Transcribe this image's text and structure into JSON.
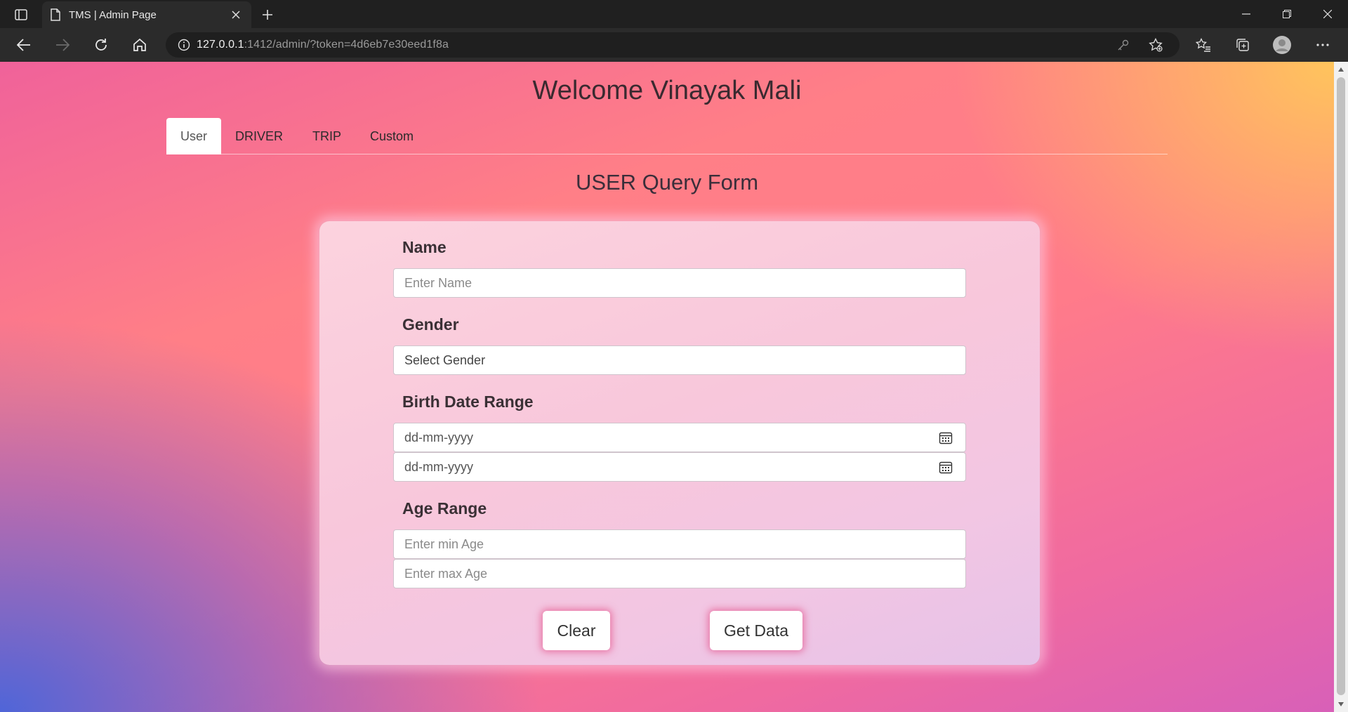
{
  "browser": {
    "tab_title": "TMS | Admin Page",
    "url_host": "127.0.0.1",
    "url_rest": ":1412/admin/?token=4d6eb7e30eed1f8a"
  },
  "page": {
    "welcome": "Welcome Vinayak Mali",
    "tabs": [
      {
        "label": "User",
        "active": true
      },
      {
        "label": "DRIVER",
        "active": false
      },
      {
        "label": "TRIP",
        "active": false
      },
      {
        "label": "Custom",
        "active": false
      }
    ],
    "form_title": "USER Query Form",
    "form": {
      "name_label": "Name",
      "name_placeholder": "Enter Name",
      "gender_label": "Gender",
      "gender_value": "Select Gender",
      "birth_label": "Birth Date Range",
      "birth_from_placeholder": "dd-mm-yyyy",
      "birth_to_placeholder": "dd-mm-yyyy",
      "age_label": "Age Range",
      "age_min_placeholder": "Enter min Age",
      "age_max_placeholder": "Enter max Age",
      "clear_label": "Clear",
      "get_data_label": "Get Data"
    }
  }
}
